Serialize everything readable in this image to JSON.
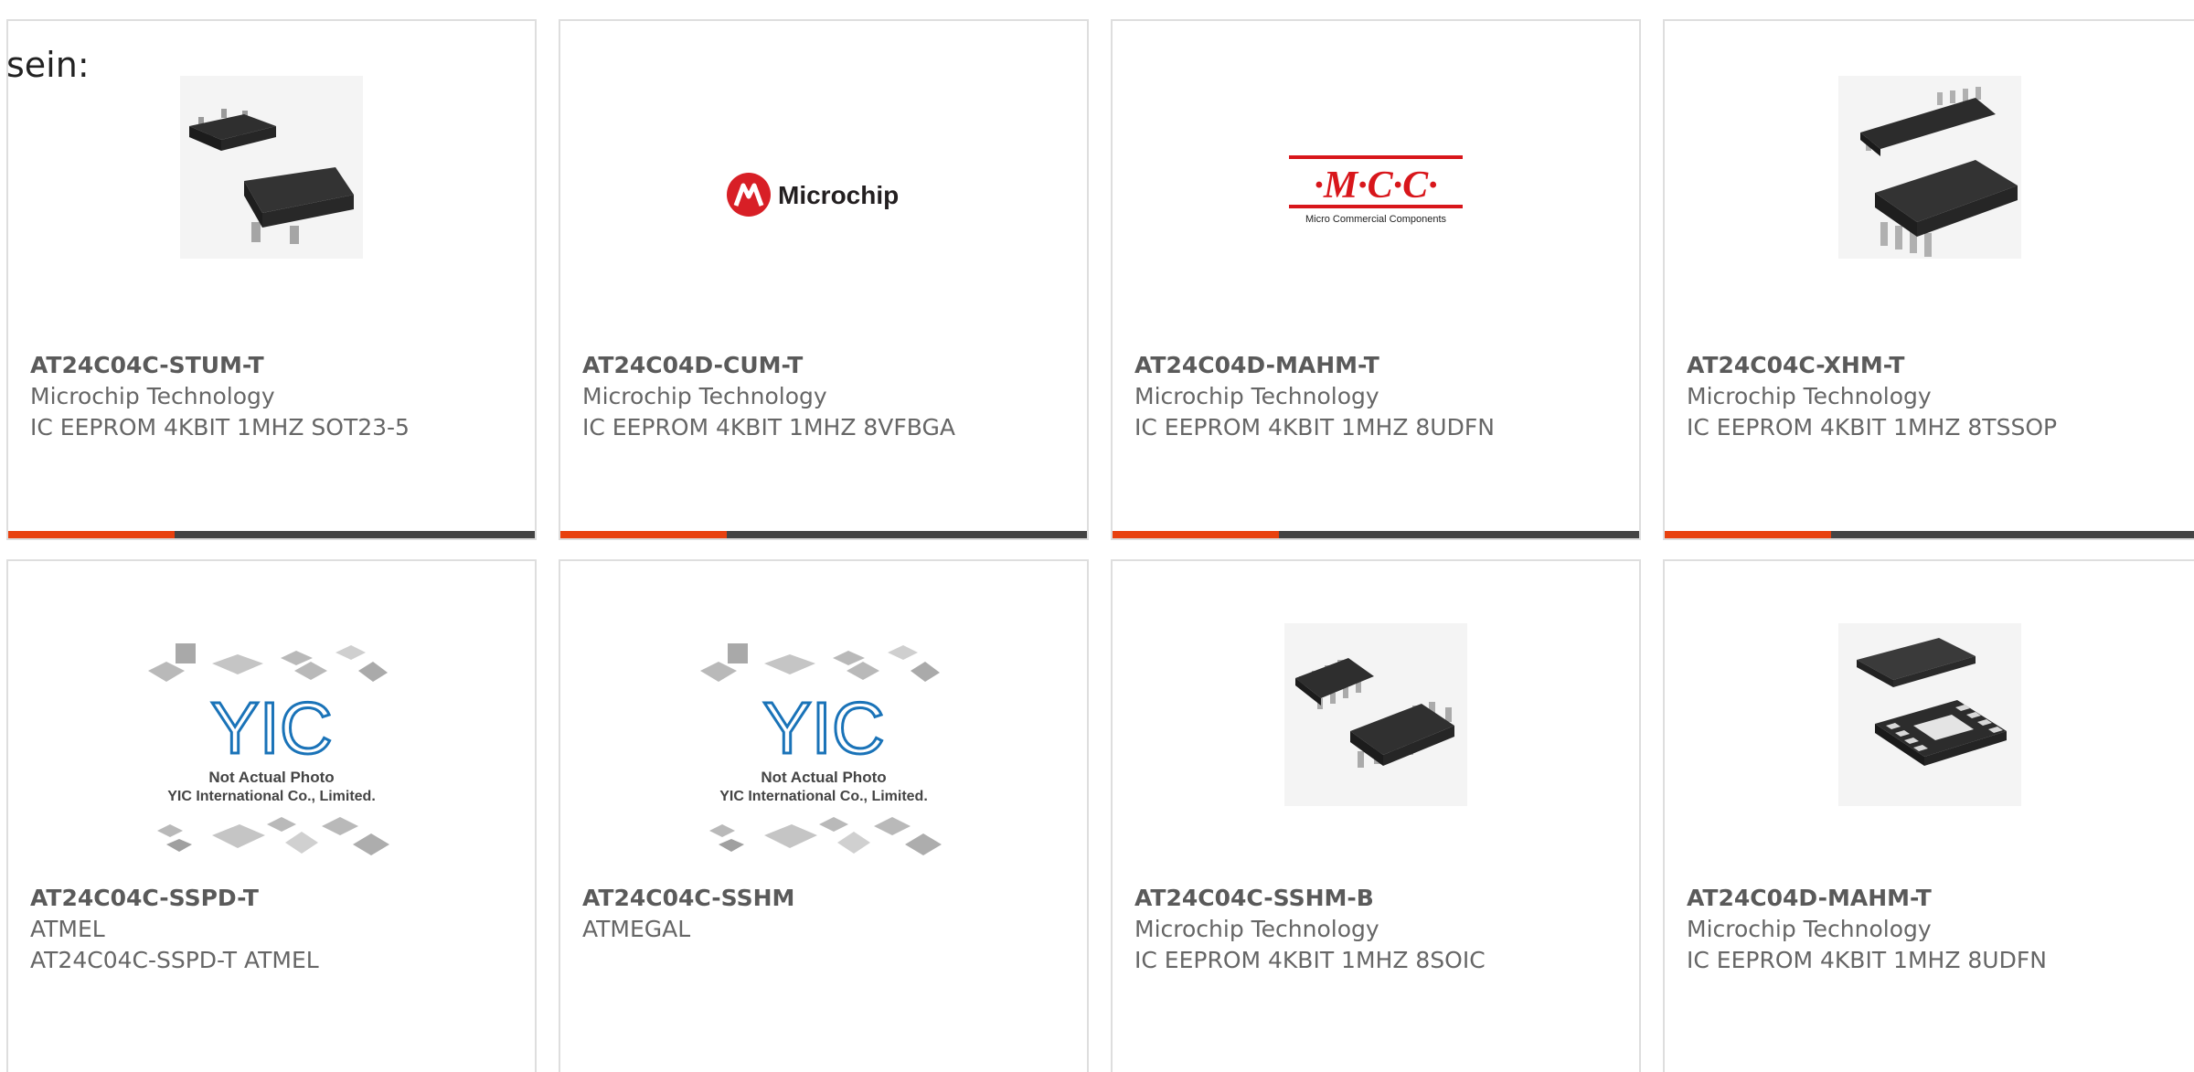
{
  "intro_text": "sein:",
  "colors": {
    "accent": "#e8410f",
    "bar": "#444444",
    "border": "#dedede",
    "microchip_red": "#d81f26",
    "mcc_red": "#d8161b",
    "yic_blue": "#1a73b8"
  },
  "products": [
    {
      "part_number": "AT24C04C-STUM-T",
      "manufacturer": "Microchip Technology",
      "description": "IC EEPROM 4KBIT 1MHZ SOT23-5",
      "image": "sot23-5-package-photo"
    },
    {
      "part_number": "AT24C04D-CUM-T",
      "manufacturer": "Microchip Technology",
      "description": "IC EEPROM 4KBIT 1MHZ 8VFBGA",
      "image": "microchip-logo",
      "logo_text": "Microchip"
    },
    {
      "part_number": "AT24C04D-MAHM-T",
      "manufacturer": "Microchip Technology",
      "description": "IC EEPROM 4KBIT 1MHZ 8UDFN",
      "image": "mcc-logo",
      "logo_text": "·M·C·C·",
      "logo_subtext": "Micro Commercial Components"
    },
    {
      "part_number": "AT24C04C-XHM-T",
      "manufacturer": "Microchip Technology",
      "description": "IC EEPROM 4KBIT 1MHZ 8TSSOP",
      "image": "tssop-package-photo"
    },
    {
      "part_number": "AT24C04C-SSPD-T",
      "manufacturer": "ATMEL",
      "description": "AT24C04C-SSPD-T ATMEL",
      "image": "yic-placeholder",
      "logo_text": "YIC",
      "placeholder_line1": "Not Actual Photo",
      "placeholder_line2": "YIC International Co., Limited."
    },
    {
      "part_number": "AT24C04C-SSHM",
      "manufacturer": "ATMEGAL",
      "description": "",
      "image": "yic-placeholder",
      "logo_text": "YIC",
      "placeholder_line1": "Not Actual Photo",
      "placeholder_line2": "YIC International Co., Limited."
    },
    {
      "part_number": "AT24C04C-SSHM-B",
      "manufacturer": "Microchip Technology",
      "description": "IC EEPROM 4KBIT 1MHZ 8SOIC",
      "image": "soic-package-photo"
    },
    {
      "part_number": "AT24C04D-MAHM-T",
      "manufacturer": "Microchip Technology",
      "description": "IC EEPROM 4KBIT 1MHZ 8UDFN",
      "image": "udfn-package-photo"
    }
  ]
}
